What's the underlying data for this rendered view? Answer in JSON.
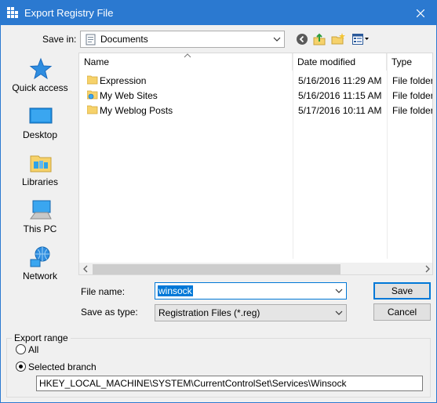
{
  "window": {
    "title": "Export Registry File"
  },
  "toolbar": {
    "save_in_label": "Save in:",
    "save_in_value": "Documents"
  },
  "places": [
    {
      "label": "Quick access",
      "icon": "star-icon"
    },
    {
      "label": "Desktop",
      "icon": "desktop-icon"
    },
    {
      "label": "Libraries",
      "icon": "libraries-icon"
    },
    {
      "label": "This PC",
      "icon": "computer-icon"
    },
    {
      "label": "Network",
      "icon": "network-icon"
    }
  ],
  "filelist": {
    "columns": [
      "Name",
      "Date modified",
      "Type"
    ],
    "rows": [
      {
        "name": "Expression",
        "date": "5/16/2016 11:29 AM",
        "type": "File folder",
        "icon": "folder-icon"
      },
      {
        "name": "My Web Sites",
        "date": "5/16/2016 11:15 AM",
        "type": "File folder",
        "icon": "web-folder-icon"
      },
      {
        "name": "My Weblog Posts",
        "date": "5/17/2016 10:11 AM",
        "type": "File folder",
        "icon": "folder-icon"
      }
    ]
  },
  "form": {
    "file_name_label": "File name:",
    "file_name_value": "winsock",
    "save_as_type_label": "Save as type:",
    "save_as_type_value": "Registration Files (*.reg)",
    "save_label": "Save",
    "cancel_label": "Cancel"
  },
  "export_range": {
    "legend": "Export range",
    "all_label": "All",
    "selected_label": "Selected branch",
    "selected": "Selected branch",
    "branch_path": "HKEY_LOCAL_MACHINE\\SYSTEM\\CurrentControlSet\\Services\\Winsock"
  },
  "colors": {
    "titlebar": "#2b79d0",
    "selection": "#0078d7",
    "folder": "#f6d26b"
  }
}
